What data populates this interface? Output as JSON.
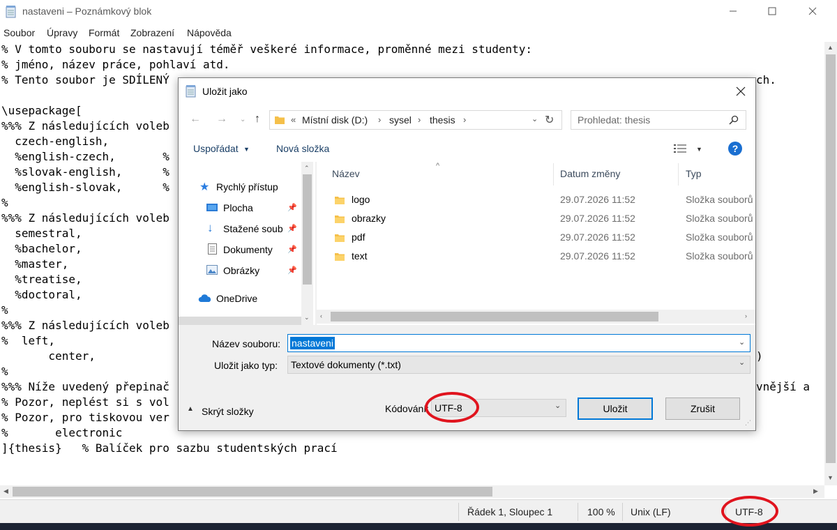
{
  "notepad": {
    "title": "nastaveni – Poznámkový blok",
    "menu": [
      "Soubor",
      "Úpravy",
      "Formát",
      "Zobrazení",
      "Nápověda"
    ],
    "lines": [
      "% V tomto souboru se nastavují téměř veškeré informace, proměnné mezi studenty:",
      "% jméno, název práce, pohlaví atd.",
      "% Tento soubor je SDÍLENÝ",
      "",
      "\\usepackage[",
      "%%% Z následujících voleb",
      "  czech-english,",
      "  %english-czech,       %",
      "  %slovak-english,      %",
      "  %english-slovak,      %",
      "%",
      "%%% Z následujících voleb",
      "  semestral,",
      "  %bachelor,",
      "  %master,",
      "  %treatise,",
      "  %doctoral,",
      "%",
      "%%% Z následujících voleb",
      "%  left,",
      "       center,",
      "%",
      "%%% Níže uvedený přepinač",
      "% Pozor, neplést si s vol",
      "% Pozor, pro tiskovou ver",
      "%       electronic",
      "]{thesis}   % Balíček pro sazbu studentských prací"
    ],
    "right_fragments": {
      "line3_end": "ch.",
      "line21_end": ")",
      "line23_end": "vnější a"
    },
    "status": {
      "position": "Řádek 1, Sloupec 1",
      "zoom": "100 %",
      "line_ending": "Unix (LF)",
      "encoding": "UTF-8"
    }
  },
  "dialog": {
    "title": "Uložit jako",
    "breadcrumb": {
      "overflow": "«",
      "parts": [
        "Místní disk (D:)",
        "sysel",
        "thesis"
      ]
    },
    "search_placeholder": "Prohledat: thesis",
    "toolbar": {
      "organize": "Uspořádat",
      "new_folder": "Nová složka"
    },
    "nav": [
      {
        "label": "Rychlý přístup",
        "icon": "star-icon",
        "pinned": false
      },
      {
        "label": "Plocha",
        "icon": "desktop-icon",
        "pinned": true
      },
      {
        "label": "Stažené soub",
        "icon": "download-icon",
        "pinned": true
      },
      {
        "label": "Dokumenty",
        "icon": "documents-icon",
        "pinned": true
      },
      {
        "label": "Obrázky",
        "icon": "pictures-icon",
        "pinned": true
      },
      {
        "label": "OneDrive",
        "icon": "cloud-icon",
        "pinned": false
      }
    ],
    "columns": {
      "name": "Název",
      "date": "Datum změny",
      "type": "Typ"
    },
    "files": [
      {
        "name": "logo",
        "date": "29.07.2026 11:52",
        "type": "Složka souborů"
      },
      {
        "name": "obrazky",
        "date": "29.07.2026 11:52",
        "type": "Složka souborů"
      },
      {
        "name": "pdf",
        "date": "29.07.2026 11:52",
        "type": "Složka souborů"
      },
      {
        "name": "text",
        "date": "29.07.2026 11:52",
        "type": "Složka souborů"
      }
    ],
    "filename_label": "Název souboru:",
    "filename_value": "nastaveni",
    "filetype_label": "Uložit jako typ:",
    "filetype_value": "Textové dokumenty (*.txt)",
    "hide_folders": "Skrýt složky",
    "encoding_label": "Kódování:",
    "encoding_value": "UTF-8",
    "save": "Uložit",
    "cancel": "Zrušit"
  },
  "colors": {
    "accent": "#0078d7",
    "annotation": "#e0141e",
    "folder": "#f5c04a"
  }
}
